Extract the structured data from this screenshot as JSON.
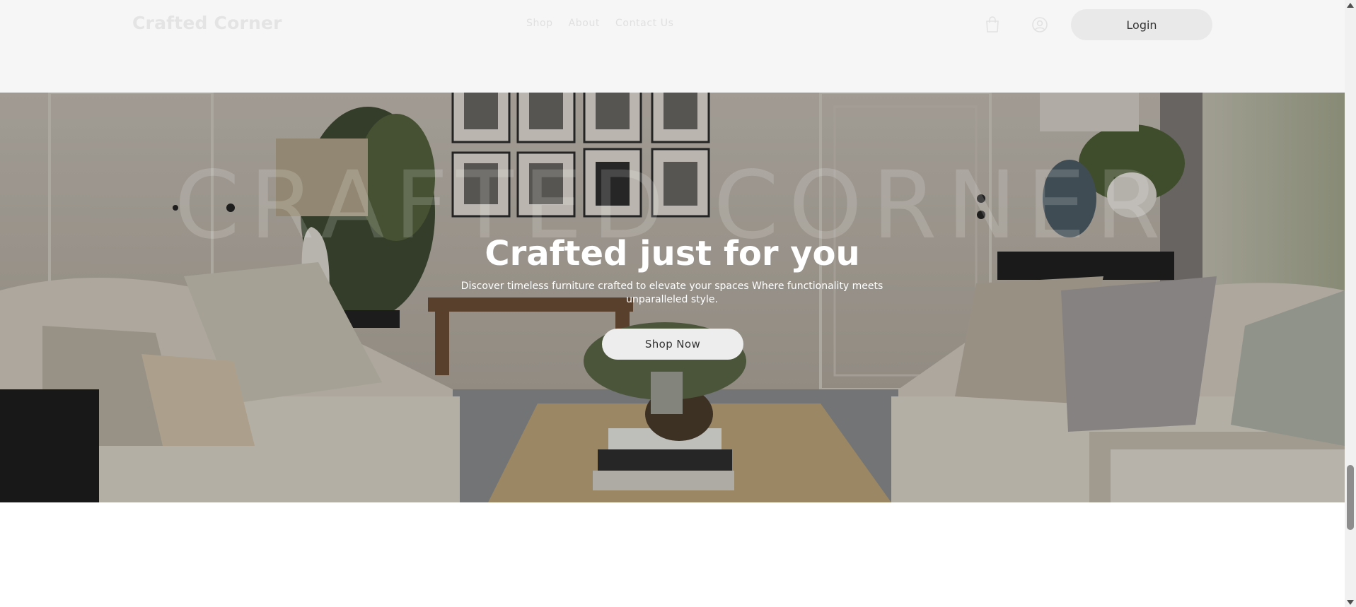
{
  "header": {
    "logo": "Crafted Corner",
    "nav": [
      "Shop",
      "About",
      "Contact Us"
    ],
    "cart_icon": "shopping-bag-icon",
    "user_icon": "user-circle-icon",
    "login_label": "Login"
  },
  "hero": {
    "watermark": "CRAFTED CORNER",
    "title": "Crafted just for you",
    "subtitle": "Discover timeless furniture crafted to elevate your spaces Where functionality meets unparalleled style.",
    "cta_label": "Shop Now"
  },
  "colors": {
    "header_bg": "#f6f6f6",
    "button_bg": "#ededed",
    "button_text": "#333333",
    "hero_text": "#ffffff"
  },
  "scrollbar": {
    "position": 0.77
  }
}
